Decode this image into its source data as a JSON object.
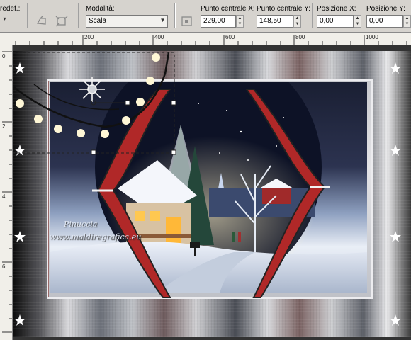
{
  "toolbar": {
    "preset_label": "redef.:",
    "mode_label": "Modalità:",
    "mode_value": "Scala",
    "center_x_label": "Punto centrale X:",
    "center_x_value": "229,00",
    "center_y_label": "Punto centrale Y:",
    "center_y_value": "148,50",
    "pos_x_label": "Posizione X:",
    "pos_x_value": "0,00",
    "pos_y_label": "Posizione Y:",
    "pos_y_value": "0,00"
  },
  "ruler": {
    "top_ticks": [
      "200",
      "400",
      "600",
      "800",
      "1000"
    ],
    "left_ticks": [
      "0",
      "2",
      "4",
      "6"
    ]
  },
  "artwork": {
    "watermark_line1": "Pinuccia",
    "watermark_line2": "www.maldiregrafica.eu"
  }
}
